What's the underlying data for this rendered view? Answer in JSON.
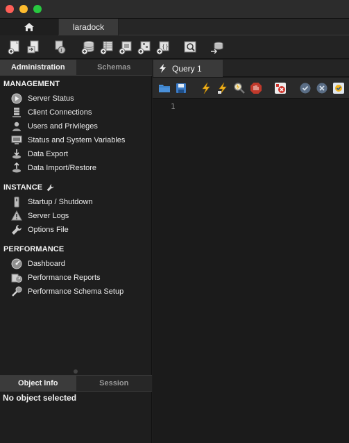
{
  "window": {
    "connection_tab": "laradock"
  },
  "toolbar": {
    "buttons": [
      "new-sql-tab-icon",
      "open-sql-script-icon",
      "inspector-icon",
      "create-schema-icon",
      "create-table-icon",
      "create-view-icon",
      "create-procedure-icon",
      "create-function-icon",
      "search-table-data-icon",
      "reconnect-icon"
    ]
  },
  "sidebar": {
    "tabs": [
      {
        "label": "Administration",
        "active": true
      },
      {
        "label": "Schemas",
        "active": false
      }
    ],
    "sections": [
      {
        "title": "MANAGEMENT",
        "items": [
          {
            "label": "Server Status",
            "icon": "play-circle-icon"
          },
          {
            "label": "Client Connections",
            "icon": "client-connections-icon"
          },
          {
            "label": "Users and Privileges",
            "icon": "user-icon"
          },
          {
            "label": "Status and System Variables",
            "icon": "monitor-icon"
          },
          {
            "label": "Data Export",
            "icon": "data-export-icon"
          },
          {
            "label": "Data Import/Restore",
            "icon": "data-import-icon"
          }
        ]
      },
      {
        "title": "INSTANCE",
        "title_icon": "wrench-icon",
        "items": [
          {
            "label": "Startup / Shutdown",
            "icon": "server-icon"
          },
          {
            "label": "Server Logs",
            "icon": "warning-icon"
          },
          {
            "label": "Options File",
            "icon": "wrench-icon"
          }
        ]
      },
      {
        "title": "PERFORMANCE",
        "items": [
          {
            "label": "Dashboard",
            "icon": "dashboard-icon"
          },
          {
            "label": "Performance Reports",
            "icon": "performance-reports-icon"
          },
          {
            "label": "Performance Schema Setup",
            "icon": "schema-setup-icon"
          }
        ]
      }
    ],
    "bottom_tabs": [
      {
        "label": "Object Info",
        "active": true
      },
      {
        "label": "Session",
        "active": false
      }
    ],
    "object_info_text": "No object selected"
  },
  "editor": {
    "tab_label": "Query 1",
    "line_numbers": [
      "1"
    ],
    "toolbar": [
      "open-file-icon",
      "save-icon",
      "execute-icon",
      "execute-current-icon",
      "explain-icon",
      "stop-icon",
      "toggle-error-icon",
      "commit-icon",
      "rollback-icon",
      "autocommit-icon"
    ]
  },
  "colors": {
    "background": "#1e1e1e",
    "accent_yellow": "#f2b31d",
    "stop_red": "#c0392b"
  }
}
